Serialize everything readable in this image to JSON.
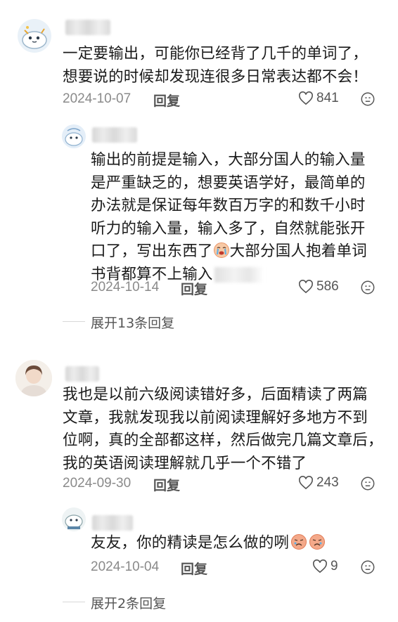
{
  "comments": [
    {
      "text_line1": "一定要输出，可能你已经背了几千的单词了，",
      "text_line2": "想要说的时候却发现连很多日常表达都不会！",
      "date": "2024-10-07",
      "reply_label": "回复",
      "likes": "841",
      "replies": [
        {
          "text_line1": "输出的前提是输入，大部分国人的输入量",
          "text_line2": "是严重缺乏的，想要英语学好，最简单的",
          "text_line3": "办法就是保证每年数百万字的和数千小时",
          "text_line4": "听力的输入量，输入多了，自然就能张开",
          "text_line5a": "口了，写出东西了",
          "text_line5b": "大部分国人抱着单词",
          "text_line6": "书背都算不上输入",
          "date": "2024-10-14",
          "reply_label": "回复",
          "likes": "586"
        }
      ],
      "expand_label": "展开13条回复"
    },
    {
      "text_line1": "我也是以前六级阅读错好多，后面精读了两篇",
      "text_line2": "文章，我就发现我以前阅读理解好多地方不到",
      "text_line3": "位啊，真的全部都这样，然后做完几篇文章后，",
      "text_line4": "我的英语阅读理解就几乎一个不错了",
      "date": "2024-09-30",
      "reply_label": "回复",
      "likes": "243",
      "replies": [
        {
          "text_line1": "友友，你的精读是怎么做的咧",
          "date": "2024-10-04",
          "reply_label": "回复",
          "likes": "9"
        }
      ],
      "expand_label": "展开2条回复"
    }
  ],
  "icons": {
    "like": "heart-outline-icon",
    "dislike": "dislike-face-icon",
    "emoji": "crying-emoji-icon"
  }
}
